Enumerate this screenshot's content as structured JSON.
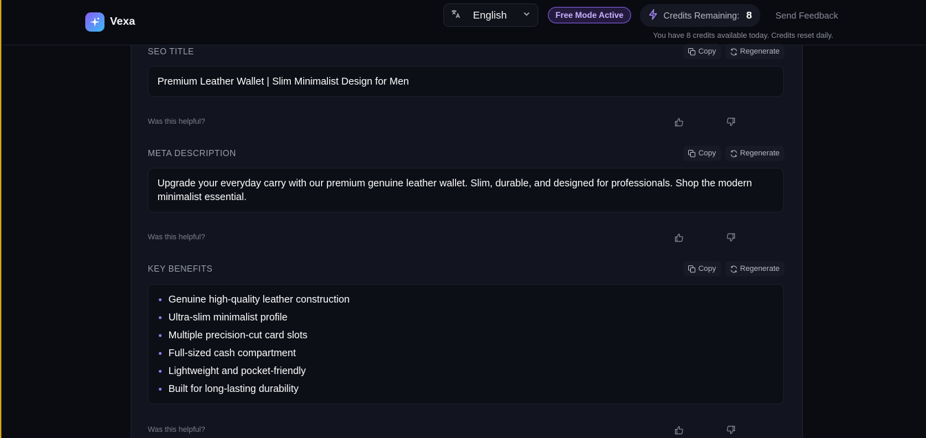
{
  "brand": {
    "name": "Vexa",
    "logo_icon": "sparkles-icon",
    "accent": "#8b5cf6"
  },
  "language": {
    "selected": "English",
    "icon": "translate-icon"
  },
  "status": {
    "free_mode": "Free Mode Active"
  },
  "credits": {
    "label": "Credits Remaining:",
    "value": "8",
    "note": "You have 8 credits available today. Credits reset daily."
  },
  "feedback": {
    "label": "Send Feedback"
  },
  "sections": {
    "seo": {
      "label": "SEO TITLE",
      "copy": "Copy",
      "regenerate": "Regenerate",
      "content": "Premium Leather Wallet | Slim Minimalist Design for Men",
      "helpful": "Was this helpful?"
    },
    "meta": {
      "label": "META DESCRIPTION",
      "copy": "Copy",
      "regenerate": "Regenerate",
      "content": "Upgrade your everyday carry with our premium genuine leather wallet. Slim, durable, and designed for professionals. Shop the modern minimalist essential.",
      "helpful": "Was this helpful?"
    },
    "benefits": {
      "label": "KEY BENEFITS",
      "copy": "Copy",
      "regenerate": "Regenerate",
      "items": [
        "Genuine high-quality leather construction",
        "Ultra-slim minimalist profile",
        "Multiple precision-cut card slots",
        "Full-sized cash compartment",
        "Lightweight and pocket-friendly",
        "Built for long-lasting durability"
      ],
      "helpful": "Was this helpful?"
    }
  }
}
